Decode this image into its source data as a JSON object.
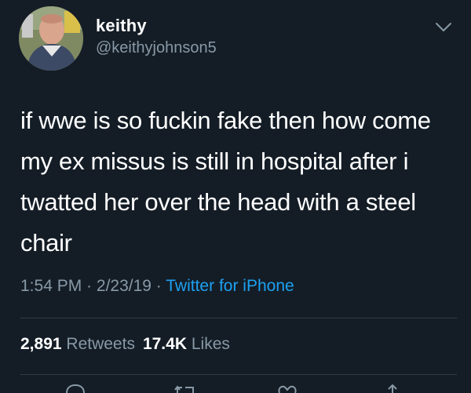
{
  "user": {
    "display_name": "keithy",
    "username": "@keithyjohnson5",
    "avatar_icon": "profile-photo"
  },
  "tweet": {
    "text": "if wwe is so fuckin fake then how come my ex missus is still in hospital after i twatted her over the head with a steel chair",
    "time": "1:54 PM",
    "date": "2/23/19",
    "separator": " · ",
    "source": "Twitter for iPhone"
  },
  "stats": {
    "retweets_count": "2,891",
    "retweets_label": "Retweets",
    "likes_count": "17.4K",
    "likes_label": "Likes"
  },
  "colors": {
    "background": "#141d26",
    "text": "#ffffff",
    "secondary": "#8899a6",
    "link": "#1da1f2",
    "divider": "#2f3b47"
  },
  "icons": [
    "chevron-down-icon",
    "reply-icon",
    "retweet-icon",
    "like-icon",
    "share-icon"
  ]
}
